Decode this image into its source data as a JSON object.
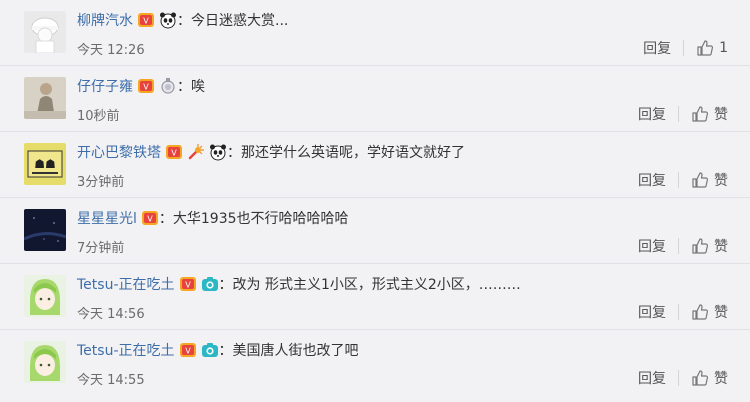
{
  "comments": [
    {
      "user": "柳牌汽水",
      "badges": [
        "vip-badge-icon",
        "panda-icon"
      ],
      "text": "：今日迷惑大赏...",
      "time": "今天 12:26",
      "reply_label": "回复",
      "like_label": "1"
    },
    {
      "user": "仔仔子雍",
      "badges": [
        "vip-badge-icon",
        "medal-icon"
      ],
      "text": "：唉",
      "time": "10秒前",
      "reply_label": "回复",
      "like_label": "赞"
    },
    {
      "user": "开心巴黎铁塔",
      "badges": [
        "vip-badge-icon",
        "firework-icon",
        "panda-icon"
      ],
      "text": "：那还学什么英语呢，学好语文就好了",
      "time": "3分钟前",
      "reply_label": "回复",
      "like_label": "赞"
    },
    {
      "user": "星星星光l",
      "badges": [
        "vip-badge-icon"
      ],
      "text": "：大华1935也不行哈哈哈哈哈",
      "time": "7分钟前",
      "reply_label": "回复",
      "like_label": "赞"
    },
    {
      "user": "Tetsu-正在吃土",
      "badges": [
        "vip-badge-icon",
        "camera-icon"
      ],
      "text": "：改为 形式主义1小区，形式主义2小区，………",
      "time": "今天 14:56",
      "reply_label": "回复",
      "like_label": "赞"
    },
    {
      "user": "Tetsu-正在吃土",
      "badges": [
        "vip-badge-icon",
        "camera-icon"
      ],
      "text": "：美国唐人街也改了吧",
      "time": "今天 14:55",
      "reply_label": "回复",
      "like_label": "赞"
    }
  ],
  "colors": {
    "username": "#3d6ea8",
    "background": "#f2f2f5",
    "vip": "#e8423d",
    "vip_gold": "#f5a623",
    "camera": "#2bb8c4"
  }
}
